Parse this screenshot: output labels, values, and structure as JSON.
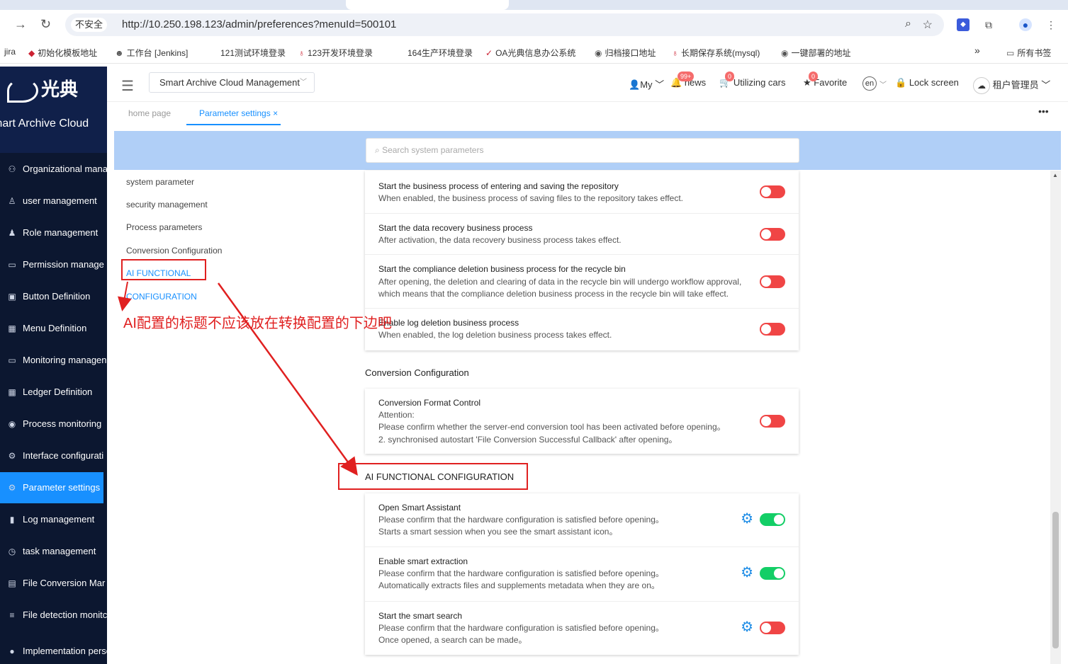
{
  "browser": {
    "security_label": "不安全",
    "url": "http://10.250.198.123/admin/preferences?menuId=500101",
    "bookmarks": [
      "jira",
      "初始化模板地址",
      "工作台 [Jenkins]",
      "121测试环境登录",
      "123开发环境登录",
      "164生产环境登录",
      "OA光典信息办公系统",
      "归档接口地址",
      "长期保存系统(mysql)",
      "一键部署的地址",
      "所有书签"
    ]
  },
  "sidebar": {
    "logo_text": "光典",
    "brand": "mart Archive Cloud",
    "items": [
      {
        "label": "Organizational mana",
        "icon": "org-icon"
      },
      {
        "label": "user management",
        "icon": "user-icon"
      },
      {
        "label": "Role management",
        "icon": "role-icon"
      },
      {
        "label": "Permission manage",
        "icon": "folder-icon"
      },
      {
        "label": "Button Definition",
        "icon": "button-icon"
      },
      {
        "label": "Menu Definition",
        "icon": "menu-icon"
      },
      {
        "label": "Monitoring managen",
        "icon": "monitor-icon"
      },
      {
        "label": "Ledger Definition",
        "icon": "grid-icon"
      },
      {
        "label": "Process monitoring",
        "icon": "eye-icon"
      },
      {
        "label": "Interface configurati",
        "icon": "gear-icon"
      },
      {
        "label": "Parameter settings",
        "icon": "settings-icon",
        "active": true
      },
      {
        "label": "Log management",
        "icon": "chart-icon"
      },
      {
        "label": "task management",
        "icon": "clock-icon"
      },
      {
        "label": "File Conversion Mar",
        "icon": "file-icon"
      },
      {
        "label": "File detection monitc",
        "icon": "sliders-icon"
      },
      {
        "label": "Implementation personi",
        "icon": "person-icon"
      }
    ]
  },
  "header": {
    "system_select": "Smart Archive Cloud Management",
    "my": "My",
    "news_badge": "99+",
    "news": "news",
    "cars_badge": "0",
    "cars": "Utilizing cars",
    "fav_badge": "0",
    "favorite": "Favorite",
    "lang": "en",
    "lock": "Lock screen",
    "user": "租户管理员"
  },
  "tabs": {
    "home": "home page",
    "current": "Parameter settings"
  },
  "search": {
    "placeholder": "Search system parameters"
  },
  "leftnav": [
    "system parameter",
    "security management",
    "Process parameters",
    "Conversion Configuration",
    "AI FUNCTIONAL",
    "CONFIGURATION"
  ],
  "process_rows": [
    {
      "title": "Start the business process of entering and saving the repository",
      "desc": "When enabled, the business process of saving files to the repository takes effect.",
      "on": false
    },
    {
      "title": "Start the data recovery business process",
      "desc": "After activation, the data recovery business process takes effect.",
      "on": false
    },
    {
      "title": "Start the compliance deletion business process for the recycle bin",
      "desc": "After opening, the deletion and clearing of data in the recycle bin will undergo workflow approval, which means that the compliance deletion business process in the recycle bin will take effect.",
      "on": false
    },
    {
      "title": "Enable log deletion business process",
      "desc": "When enabled, the log deletion business process takes effect.",
      "on": false
    }
  ],
  "conversion": {
    "title": "Conversion Configuration",
    "row": {
      "title": "Conversion Format Control",
      "line1": "Attention:",
      "line2": "Please confirm whether the server-end conversion tool has been activated before opening。",
      "line3": "2. synchronised autostart 'File Conversion Successful Callback' after opening。"
    }
  },
  "ai": {
    "title": "AI FUNCTIONAL CONFIGURATION",
    "rows": [
      {
        "title": "Open Smart Assistant",
        "line1": "Please confirm that the hardware configuration is satisfied before opening。",
        "line2": "Starts a smart session when you see the smart assistant icon。",
        "on": true
      },
      {
        "title": "Enable smart extraction",
        "line1": "Please confirm that the hardware configuration is satisfied before opening。",
        "line2": "Automatically extracts files and supplements metadata when they are on。",
        "on": true
      },
      {
        "title": "Start the smart search",
        "line1": "Please confirm that the hardware configuration is satisfied before opening。",
        "line2": "Once opened, a search can be made。",
        "on": false
      }
    ]
  },
  "annotation": {
    "text": "AI配置的标题不应该放在转换配置的下边吧"
  },
  "colors": {
    "sidebar_bg": "#10204a",
    "accent": "#1890ff",
    "switch_off": "#f04545",
    "switch_on": "#13ce66",
    "annotation": "#e02020"
  }
}
